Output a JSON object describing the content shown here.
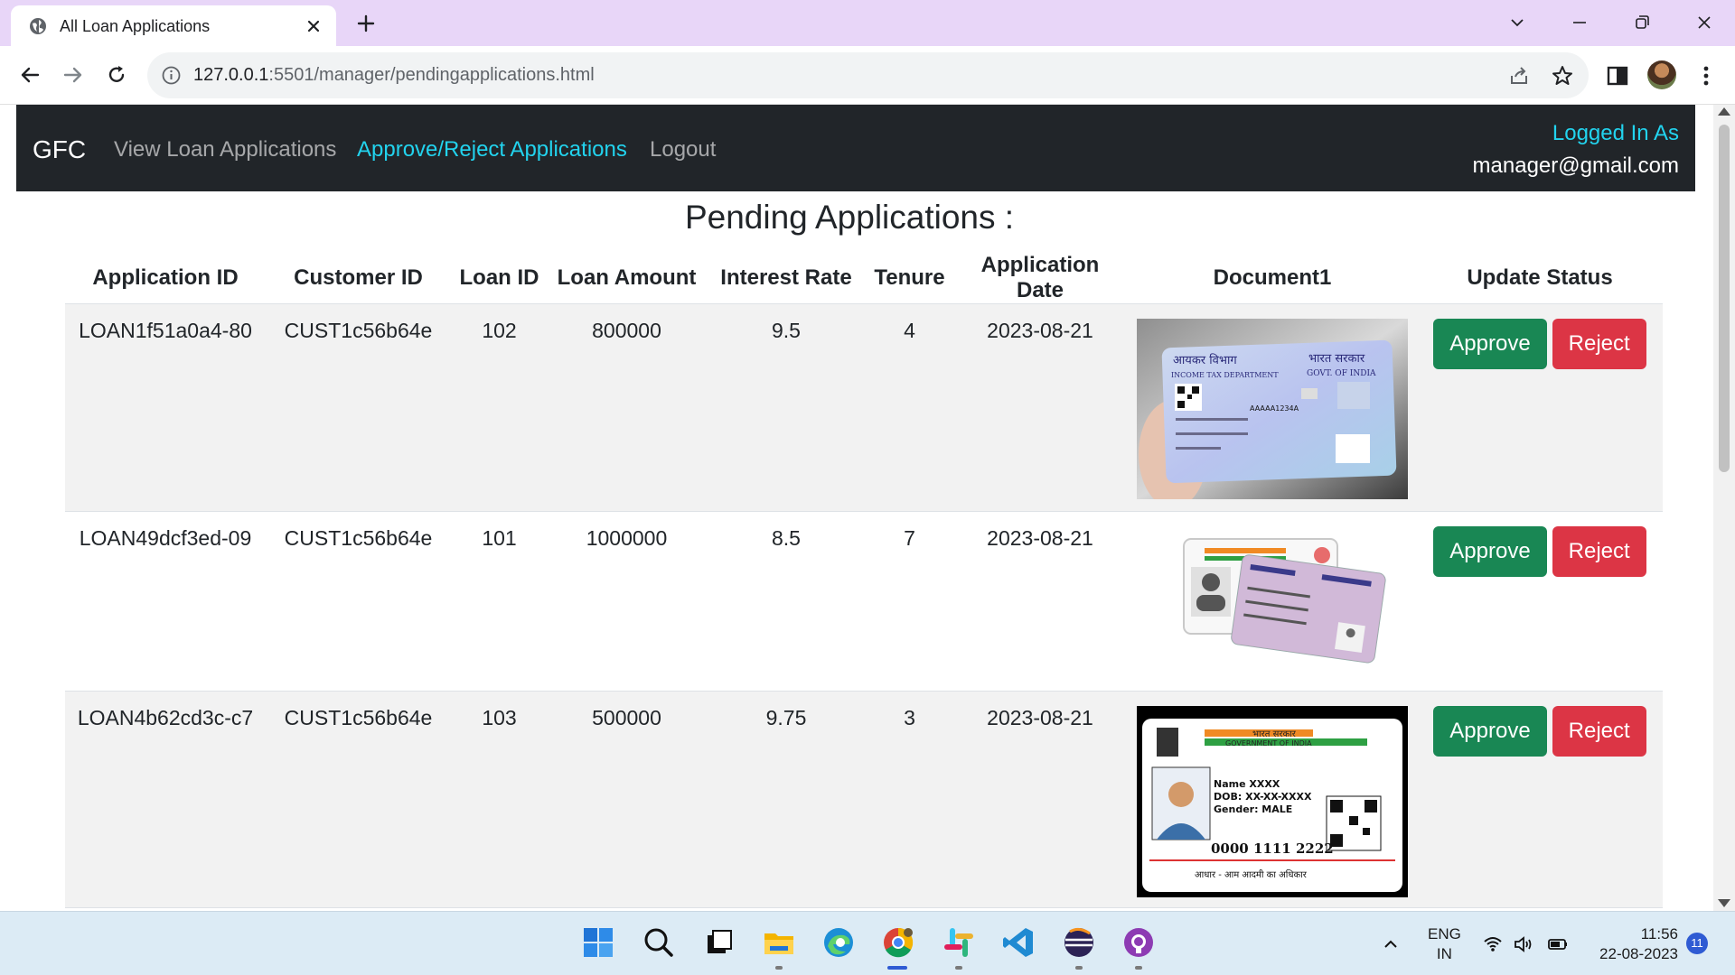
{
  "browser": {
    "tab_title": "All Loan Applications",
    "url_host": "127.0.0.1",
    "url_path": ":5501/manager/pendingapplications.html"
  },
  "navbar": {
    "brand": "GFC",
    "links": [
      "View Loan Applications",
      "Approve/Reject Applications",
      "Logout"
    ],
    "active_link": "Approve/Reject Applications",
    "logged_in_label": "Logged In As",
    "logged_in_email": "manager@gmail.com"
  },
  "page": {
    "heading": "Pending Applications :"
  },
  "table": {
    "columns": [
      "Application ID",
      "Customer ID",
      "Loan ID",
      "Loan Amount",
      "Interest Rate",
      "Tenure",
      "Application Date",
      "Document1",
      "Update Status"
    ],
    "rows": [
      {
        "application_id": "LOAN1f51a0a4-80",
        "customer_id": "CUST1c56b64e",
        "loan_id": "102",
        "loan_amount": "800000",
        "interest_rate": "9.5",
        "tenure": "4",
        "application_date": "2023-08-21",
        "document": "pan-card-image"
      },
      {
        "application_id": "LOAN49dcf3ed-09",
        "customer_id": "CUST1c56b64e",
        "loan_id": "101",
        "loan_amount": "1000000",
        "interest_rate": "8.5",
        "tenure": "7",
        "application_date": "2023-08-21",
        "document": "aadhaar-and-pan-cards-image"
      },
      {
        "application_id": "LOAN4b62cd3c-c7",
        "customer_id": "CUST1c56b64e",
        "loan_id": "103",
        "loan_amount": "500000",
        "interest_rate": "9.75",
        "tenure": "3",
        "application_date": "2023-08-21",
        "document": "aadhaar-card-image"
      }
    ],
    "approve_label": "Approve",
    "reject_label": "Reject"
  },
  "documents": {
    "pan": {
      "left_title": "आयकर विभाग",
      "right_title": "भारत सरकार",
      "dept": "INCOME TAX DEPARTMENT",
      "govt": "GOVT. OF INDIA",
      "number": "AAAAA1234A"
    },
    "aadhaar": {
      "govt_hi": "भारत सरकार",
      "govt_en": "GOVERNMENT OF INDIA",
      "name": "Name XXXX",
      "dob": "DOB: XX-XX-XXXX",
      "gender": "Gender: MALE",
      "number": "0000 1111 2222",
      "tagline": "आधार - आम आदमी का अधिकार"
    }
  },
  "taskbar": {
    "lang_line1": "ENG",
    "lang_line2": "IN",
    "time": "11:56",
    "date": "22-08-2023",
    "notifications": "11",
    "apps": [
      "start-icon",
      "search-icon",
      "task-view-icon",
      "file-explorer-icon",
      "edge-icon",
      "chrome-icon",
      "slack-icon",
      "vscode-icon",
      "eclipse-icon",
      "github-desktop-icon"
    ]
  },
  "colors": {
    "navbar_bg": "#212529",
    "active_link": "#22d3ee",
    "approve": "#198754",
    "reject": "#dc3545",
    "tabstrip": "#e8d6f8"
  }
}
